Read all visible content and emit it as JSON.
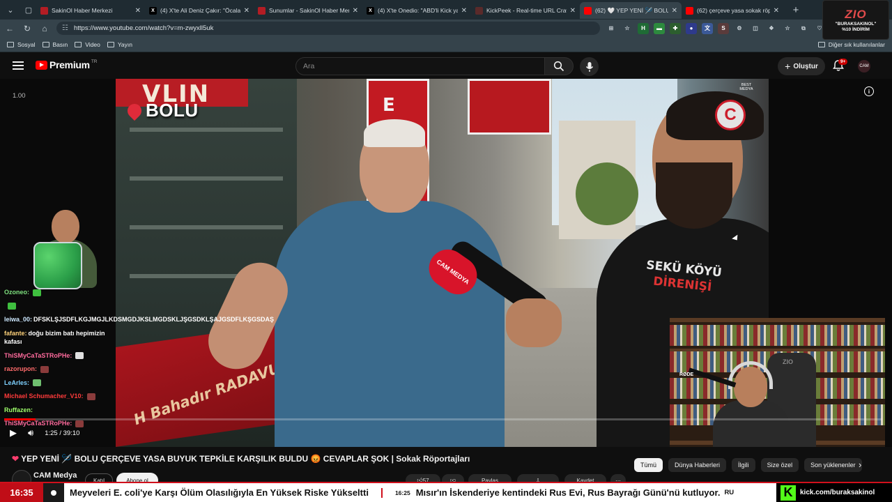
{
  "browser": {
    "tabs": [
      {
        "title": "SakinOl Haber Merkezi",
        "fav": "#b31d24",
        "favtext": ""
      },
      {
        "title": "(4) X'te Ali Deniz Çakır: \"Öcalan, Ö",
        "fav": "#000000",
        "favtext": "X"
      },
      {
        "title": "Sunumlar - SakinOl Haber Merkezi",
        "fav": "#b31d24",
        "favtext": ""
      },
      {
        "title": "(4) X'te Onedio: \"ABD'li Kick yayıncı",
        "fav": "#000000",
        "favtext": "X"
      },
      {
        "title": "KickPeek - Real-time URL Crawler",
        "fav": "#5a2a2a",
        "favtext": ""
      },
      {
        "title": "(62) 🤍 YEP YENİ 🪡 BOLU Ç",
        "fav": "#ff0000",
        "favtext": ""
      },
      {
        "title": "(62) çerçeve yasa sokak röportaj",
        "fav": "#ff0000",
        "favtext": ""
      }
    ],
    "url": "https://www.youtube.com/watch?v=m-zwyxll5uk",
    "bookmarks": [
      "Sosyal",
      "Basın",
      "Video",
      "Yayın"
    ],
    "other_bookmarks": "Diğer sık kullanılanlar"
  },
  "zio_badge": {
    "logo": "ZIO",
    "line1": "\"BURAKSAKINOL\"",
    "line2": "%10 İNDİRİM"
  },
  "youtube": {
    "logo_word": "Premium",
    "country": "TR",
    "search_placeholder": "Ara",
    "create_label": "Oluştur",
    "notifications": "9+",
    "avatar_text": "CAM"
  },
  "player": {
    "speed": "1.00",
    "location": "BOLU",
    "channel_logo": "C",
    "watermark": "BEST MEDYA",
    "current_time": "1:25",
    "duration": "39:10",
    "progress": 0.036,
    "video_signs": {
      "red_board": "VLIN",
      "e_sign": [
        "E",
        "E"
      ],
      "floor_text": "H Bahadır RADAVU",
      "mic_label": "CAM MEDYA",
      "shirt_line1": "SEKÜ KÖYÜ",
      "shirt_line2": "DİRENİŞİ"
    }
  },
  "chat": [
    {
      "user": "Ozoneo:",
      "text": "",
      "color": "#7ee07e",
      "emote": "#3fbf3f"
    },
    {
      "user": "",
      "text": "",
      "color": "#7ee07e",
      "emote": "#3fbf3f"
    },
    {
      "user": "leiwa_00:",
      "text": "DFSKLŞJSDFLKGJMGJLKDSMGDJKSLMGDSKLJŞGSDKLŞAJGSDFLKŞGSDAŞ",
      "color": "#cde8ff",
      "emote": ""
    },
    {
      "user": "fafante:",
      "text": "doğu bizim batı hepimizin kafası",
      "color": "#ffd27a",
      "emote": ""
    },
    {
      "user": "ThiSMyCaTaSTRoPHe:",
      "text": "",
      "color": "#ff6b9d",
      "emote": "#e0e0e0"
    },
    {
      "user": "razorupon:",
      "text": "",
      "color": "#ff6b6b",
      "emote": "#8a3b3b"
    },
    {
      "user": "LeArles:",
      "text": "",
      "color": "#7fd1ff",
      "emote": "#6fbf6f"
    },
    {
      "user": "Michael Schumacher_V10:",
      "text": "",
      "color": "#ff3b3b",
      "emote": "#8a3b3b"
    },
    {
      "user": "Ruffazen:",
      "text": "",
      "color": "#9fff6b",
      "emote": ""
    },
    {
      "user": "ThiSMyCaTaSTRoPHe:",
      "text": "",
      "color": "#ff6b9d",
      "emote": "#8a3b3b"
    }
  ],
  "webcam": {
    "chair_brand": "ZIO",
    "mic_label": "RØDE"
  },
  "video_info": {
    "title": "YEP YENİ 🪡 BOLU ÇERÇEVE YASA BUYUK TEPKİLE KARŞILIK BULDU 😡 CEVAPLAR ŞOK | Sokak Röportajları",
    "channel": "CAM Medya",
    "join": "Katıl",
    "subscribe": "Abone ol",
    "actions": [
      "57",
      "",
      "Paylaş",
      "Kaydet",
      "Kaydet",
      ""
    ],
    "chips": [
      "Tümü",
      "Dünya Haberleri",
      "İlgili",
      "Size özel",
      "Son yüklenenler"
    ]
  },
  "ticker": {
    "clock": "16:35",
    "items": [
      {
        "time": "",
        "text": "Meyveleri E. coli'ye Karşı Ölüm Olasılığıyla En Yüksek Riske Yükseltti"
      },
      {
        "time": "16:25",
        "text": "Mısır'ın İskenderiye kentindeki Rus Evi, Rus Bayrağı Günü'nü kutluyor."
      }
    ],
    "suffix": "RU",
    "kick_logo": "K",
    "kick_url": "kick.com/buraksakinol"
  }
}
